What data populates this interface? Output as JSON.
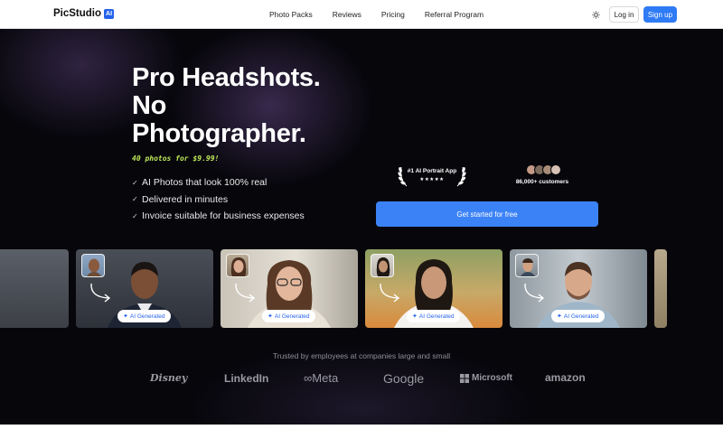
{
  "nav": {
    "logo": "PicStudio",
    "logo_badge": "AI",
    "links": [
      "Photo Packs",
      "Reviews",
      "Pricing",
      "Referral Program"
    ],
    "theme_icon": "sun-icon",
    "login": "Log in",
    "signup": "Sign up"
  },
  "hero": {
    "headline_lines": [
      "Pro Headshots.",
      "No",
      "Photographer."
    ],
    "promo": "40 photos for $9.99!",
    "features": [
      "AI Photos that look 100% real",
      "Delivered in minutes",
      "Invoice suitable for business expenses"
    ],
    "award": {
      "text": "#1 AI Portrait App",
      "stars": "★★★★★"
    },
    "customers": "86,000+ customers",
    "cta": "Get started for free"
  },
  "gallery": {
    "chip_label": "AI Generated",
    "chip_icon": "sparkle-icon"
  },
  "trusted": {
    "text": "Trusted by employees at companies large and small",
    "brands": [
      "Disney",
      "LinkedIn",
      "Meta",
      "Google",
      "Microsoft",
      "amazon"
    ]
  },
  "colors": {
    "accent": "#3b82f6",
    "promo": "#bde85b",
    "hero_bg": "#07060b"
  }
}
